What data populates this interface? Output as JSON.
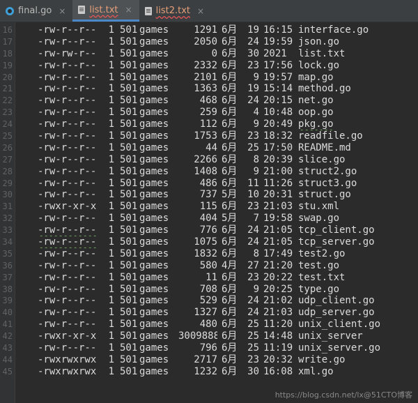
{
  "tabs": [
    {
      "label": "final.go",
      "icon": "go-file-icon",
      "active": false,
      "underline": false
    },
    {
      "label": "list.txt",
      "icon": "text-file-icon",
      "active": true,
      "underline": true
    },
    {
      "label": "list2.txt",
      "icon": "text-file-icon",
      "active": false,
      "underline": true
    }
  ],
  "close_glyph": "×",
  "line_numbers": [
    "16",
    "17",
    "18",
    "19",
    "20",
    "21",
    "22",
    "23",
    "24",
    "25",
    "26",
    "27",
    "28",
    "29",
    "30",
    "31",
    "32",
    "33",
    "34",
    "35",
    "36",
    "37",
    "38",
    "39",
    "40",
    "41",
    "42",
    "43",
    "44",
    "45"
  ],
  "rows": [
    {
      "perm": "-rw-r--r--",
      "links": "1",
      "uid": "501",
      "group": "games",
      "size": "1291",
      "month": "6月",
      "day": "19",
      "time": "16:15",
      "name": "interface.go"
    },
    {
      "perm": "-rw-r--r--",
      "links": "1",
      "uid": "501",
      "group": "games",
      "size": "2050",
      "month": "6月",
      "day": "24",
      "time": "19:59",
      "name": "json.go"
    },
    {
      "perm": "-rw-rw-r--",
      "links": "1",
      "uid": "501",
      "group": "games",
      "size": "0",
      "month": "6月",
      "day": "30",
      "time": "2021",
      "name": "list.txt"
    },
    {
      "perm": "-rw-r--r--",
      "links": "1",
      "uid": "501",
      "group": "games",
      "size": "2332",
      "month": "6月",
      "day": "23",
      "time": "17:56",
      "name": "lock.go"
    },
    {
      "perm": "-rw-r--r--",
      "links": "1",
      "uid": "501",
      "group": "games",
      "size": "2101",
      "month": "6月",
      "day": "9",
      "time": "19:57",
      "name": "map.go"
    },
    {
      "perm": "-rw-r--r--",
      "links": "1",
      "uid": "501",
      "group": "games",
      "size": "1363",
      "month": "6月",
      "day": "19",
      "time": "15:14",
      "name": "method.go"
    },
    {
      "perm": "-rw-r--r--",
      "links": "1",
      "uid": "501",
      "group": "games",
      "size": "468",
      "month": "6月",
      "day": "24",
      "time": "20:15",
      "name": "net.go"
    },
    {
      "perm": "-rw-r--r--",
      "links": "1",
      "uid": "501",
      "group": "games",
      "size": "259",
      "month": "6月",
      "day": "4",
      "time": "10:48",
      "name": "oop.go"
    },
    {
      "perm": "-rw-r--r--",
      "links": "1",
      "uid": "501",
      "group": "games",
      "size": "112",
      "month": "6月",
      "day": "9",
      "time": "20:49",
      "name": "pkg.go"
    },
    {
      "perm": "-rw-r--r--",
      "links": "1",
      "uid": "501",
      "group": "games",
      "size": "1753",
      "month": "6月",
      "day": "23",
      "time": "18:32",
      "name": "readfile.go"
    },
    {
      "perm": "-rw-r--r--",
      "links": "1",
      "uid": "501",
      "group": "games",
      "size": "44",
      "month": "6月",
      "day": "25",
      "time": "17:50",
      "name": "README.md"
    },
    {
      "perm": "-rw-r--r--",
      "links": "1",
      "uid": "501",
      "group": "games",
      "size": "2266",
      "month": "6月",
      "day": "8",
      "time": "20:39",
      "name": "slice.go"
    },
    {
      "perm": "-rw-r--r--",
      "links": "1",
      "uid": "501",
      "group": "games",
      "size": "1408",
      "month": "6月",
      "day": "9",
      "time": "21:00",
      "name": "struct2.go"
    },
    {
      "perm": "-rw-r--r--",
      "links": "1",
      "uid": "501",
      "group": "games",
      "size": "486",
      "month": "6月",
      "day": "11",
      "time": "11:26",
      "name": "struct3.go"
    },
    {
      "perm": "-rw-r--r--",
      "links": "1",
      "uid": "501",
      "group": "games",
      "size": "737",
      "month": "5月",
      "day": "10",
      "time": "20:31",
      "name": "struct.go"
    },
    {
      "perm": "-rwxr-xr-x",
      "links": "1",
      "uid": "501",
      "group": "games",
      "size": "115",
      "month": "6月",
      "day": "23",
      "time": "21:03",
      "name": "stu.xml"
    },
    {
      "perm": "-rw-r--r--",
      "links": "1",
      "uid": "501",
      "group": "games",
      "size": "404",
      "month": "5月",
      "day": "7",
      "time": "19:58",
      "name": "swap.go"
    },
    {
      "perm": "-rw-r--r--",
      "links": "1",
      "uid": "501",
      "group": "games",
      "size": "776",
      "month": "6月",
      "day": "24",
      "time": "21:05",
      "name": "tcp_client.go"
    },
    {
      "perm": "-rw-r--r--",
      "links": "1",
      "uid": "501",
      "group": "games",
      "size": "1075",
      "month": "6月",
      "day": "24",
      "time": "21:05",
      "name": "tcp_server.go"
    },
    {
      "perm": "-rw-r--r--",
      "links": "1",
      "uid": "501",
      "group": "games",
      "size": "1832",
      "month": "6月",
      "day": "8",
      "time": "17:49",
      "name": "test2.go"
    },
    {
      "perm": "-rw-r--r--",
      "links": "1",
      "uid": "501",
      "group": "games",
      "size": "580",
      "month": "4月",
      "day": "27",
      "time": "21:20",
      "name": "test.go"
    },
    {
      "perm": "-rw-r--r--",
      "links": "1",
      "uid": "501",
      "group": "games",
      "size": "11",
      "month": "6月",
      "day": "23",
      "time": "20:22",
      "name": "test.txt"
    },
    {
      "perm": "-rw-r--r--",
      "links": "1",
      "uid": "501",
      "group": "games",
      "size": "708",
      "month": "6月",
      "day": "9",
      "time": "20:25",
      "name": "type.go"
    },
    {
      "perm": "-rw-r--r--",
      "links": "1",
      "uid": "501",
      "group": "games",
      "size": "529",
      "month": "6月",
      "day": "24",
      "time": "21:02",
      "name": "udp_client.go"
    },
    {
      "perm": "-rw-r--r--",
      "links": "1",
      "uid": "501",
      "group": "games",
      "size": "1327",
      "month": "6月",
      "day": "24",
      "time": "21:03",
      "name": "udp_server.go"
    },
    {
      "perm": "-rw-r--r--",
      "links": "1",
      "uid": "501",
      "group": "games",
      "size": "480",
      "month": "6月",
      "day": "25",
      "time": "11:20",
      "name": "unix_client.go"
    },
    {
      "perm": "-rwxr-xr-x",
      "links": "1",
      "uid": "501",
      "group": "games",
      "size": "3009888",
      "month": "6月",
      "day": "25",
      "time": "14:48",
      "name": "unix_server"
    },
    {
      "perm": "-rw-r--r--",
      "links": "1",
      "uid": "501",
      "group": "games",
      "size": "796",
      "month": "6月",
      "day": "25",
      "time": "11:19",
      "name": "unix_server.go"
    },
    {
      "perm": "-rwxrwxrwx",
      "links": "1",
      "uid": "501",
      "group": "games",
      "size": "2717",
      "month": "6月",
      "day": "23",
      "time": "20:32",
      "name": "write.go"
    },
    {
      "perm": "-rwxrwxrwx",
      "links": "1",
      "uid": "501",
      "group": "games",
      "size": "1232",
      "month": "6月",
      "day": "30",
      "time": "16:08",
      "name": "xml.go"
    }
  ],
  "warn_perm_rows": [
    33,
    34
  ],
  "warn_name_rows": [
    9
  ],
  "watermark": "https://blog.csdn.net/lx@51CTO博客"
}
